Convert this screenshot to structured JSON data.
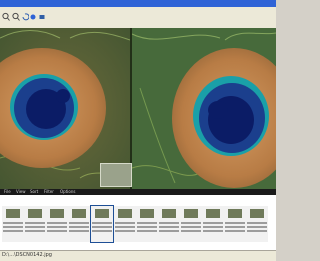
{
  "window": {
    "title_bar_color": "#2f63d6"
  },
  "toolbar": {
    "buttons": [
      {
        "icon": "zoom-out-icon"
      },
      {
        "icon": "zoom-in-icon"
      },
      {
        "icon": "rotate-icon"
      },
      {
        "icon": "refresh-icon"
      },
      {
        "icon": "settings-icon"
      }
    ]
  },
  "viewer": {
    "panes": [
      "left-image",
      "right-image"
    ],
    "subject": "peacock feather eye"
  },
  "filmstrip": {
    "tabs": [
      "File",
      "View",
      "Sort",
      "Filter",
      "Options"
    ],
    "thumbnail_count": 15,
    "selected_index": 4
  },
  "status": {
    "path": "D:\\...\\DSCN0142.jpg"
  }
}
